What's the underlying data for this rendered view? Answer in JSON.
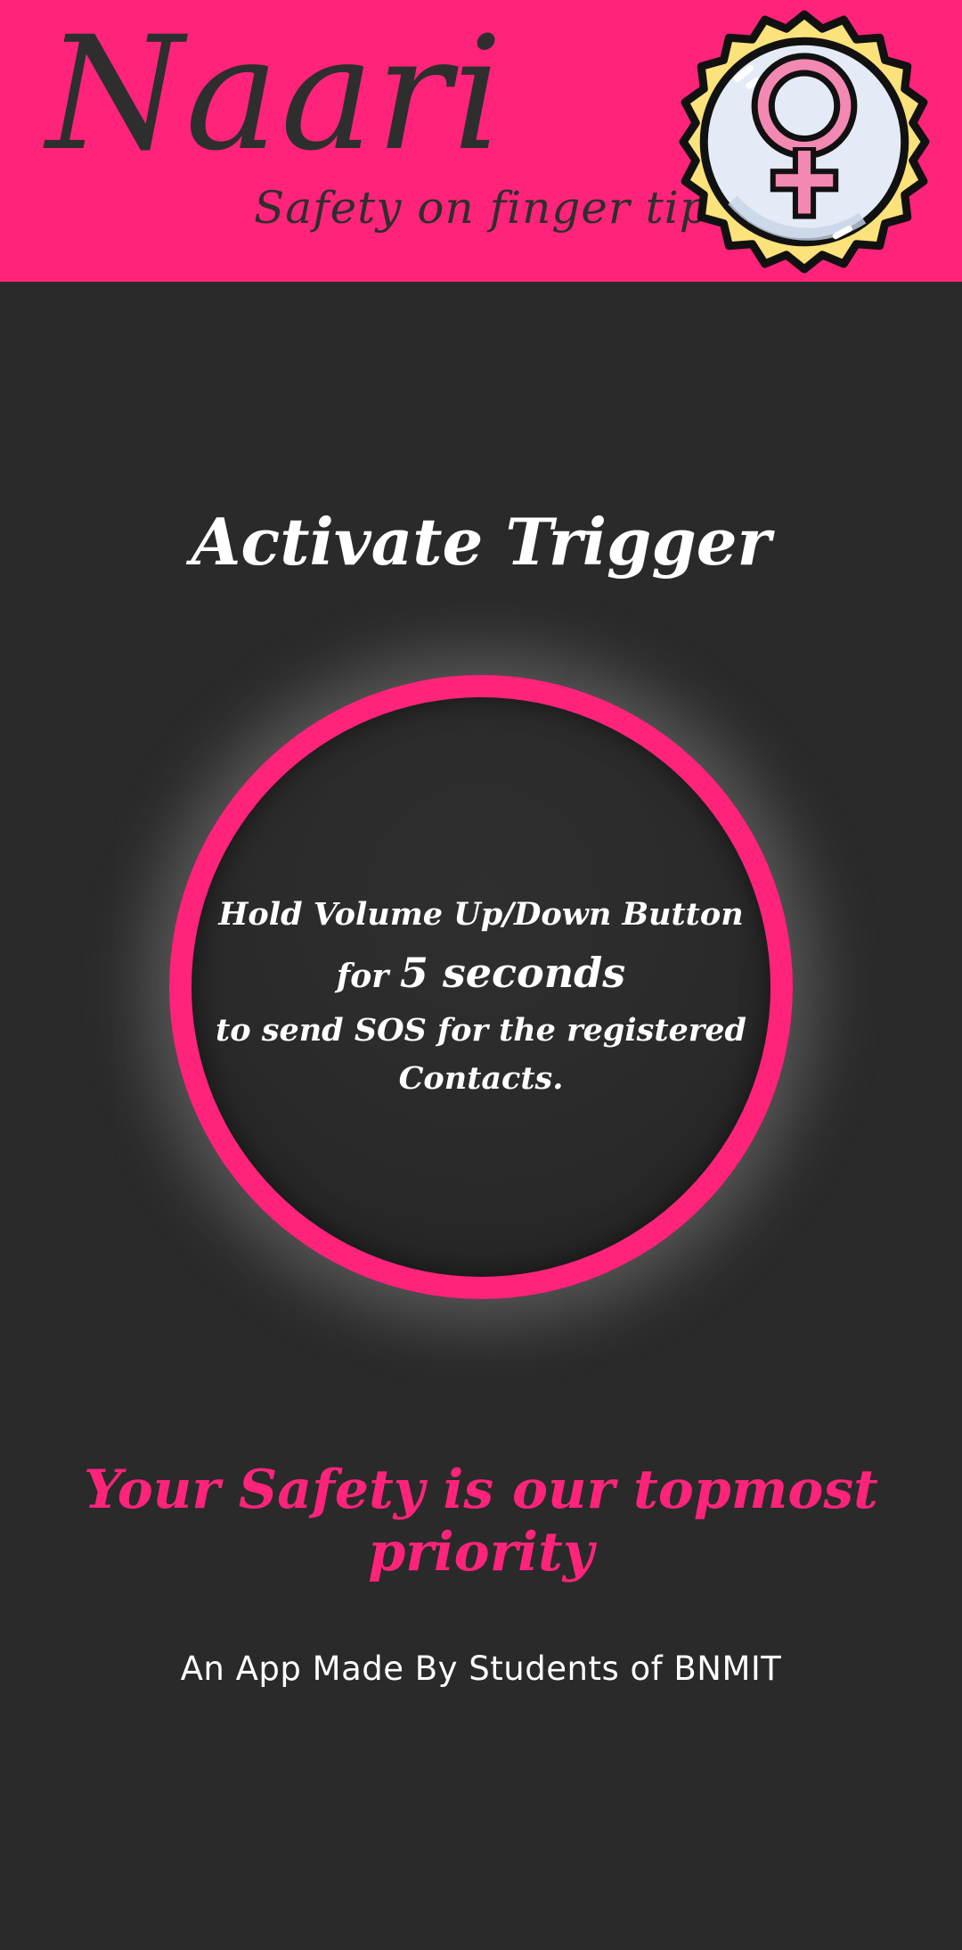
{
  "header": {
    "app_name": "Naari",
    "tagline": "Safety on finger tips",
    "logo_icon": "female-symbol-badge-icon",
    "background_color": "#ff2479"
  },
  "main": {
    "title": "Activate Trigger",
    "trigger": {
      "ring_color": "#ff2479",
      "line1": "Hold Volume Up/Down Button",
      "line2_prefix": "for",
      "line2_emphasis": "5 seconds",
      "line3": "to send SOS for the registered",
      "line4": "Contacts."
    },
    "priority_text": "Your Safety is our topmost priority",
    "priority_color": "#ff2479"
  },
  "footer": {
    "credit": "An App Made By Students of BNMIT"
  },
  "colors": {
    "background": "#2a2a2a",
    "accent": "#ff2479",
    "text": "#ffffff"
  }
}
